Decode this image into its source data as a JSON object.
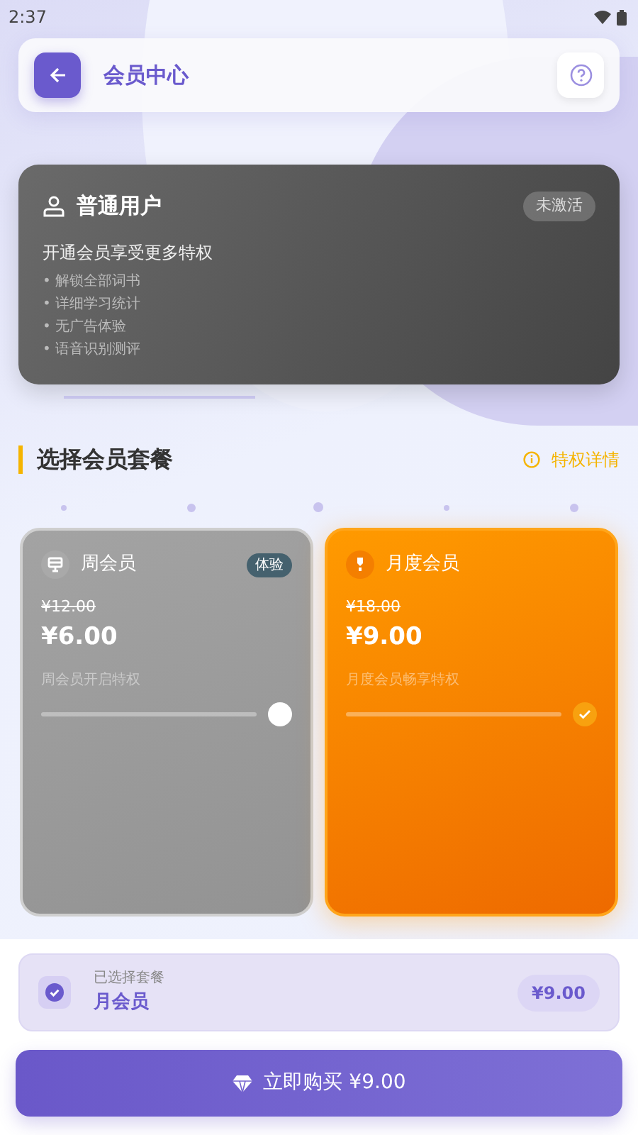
{
  "status_bar": {
    "time": "2:37"
  },
  "header": {
    "title": "会员中心"
  },
  "user_card": {
    "title": "普通用户",
    "badge": "未激活",
    "subtitle": "开通会员享受更多特权",
    "benefits": [
      "• 解锁全部词书",
      "• 详细学习统计",
      "• 无广告体验",
      "• 语音识别测评"
    ]
  },
  "section": {
    "title": "选择会员套餐",
    "link": "特权详情"
  },
  "plans": [
    {
      "name": "周会员",
      "badge": "体验",
      "old_price": "¥12.00",
      "price": "¥6.00",
      "note": "周会员开启特权",
      "selected": false
    },
    {
      "name": "月度会员",
      "old_price": "¥18.00",
      "price": "¥9.00",
      "note": "月度会员畅享特权",
      "selected": true
    }
  ],
  "summary": {
    "label": "已选择套餐",
    "plan": "月会员",
    "price": "¥9.00"
  },
  "buy_button": {
    "label": "立即购买 ¥9.00"
  }
}
